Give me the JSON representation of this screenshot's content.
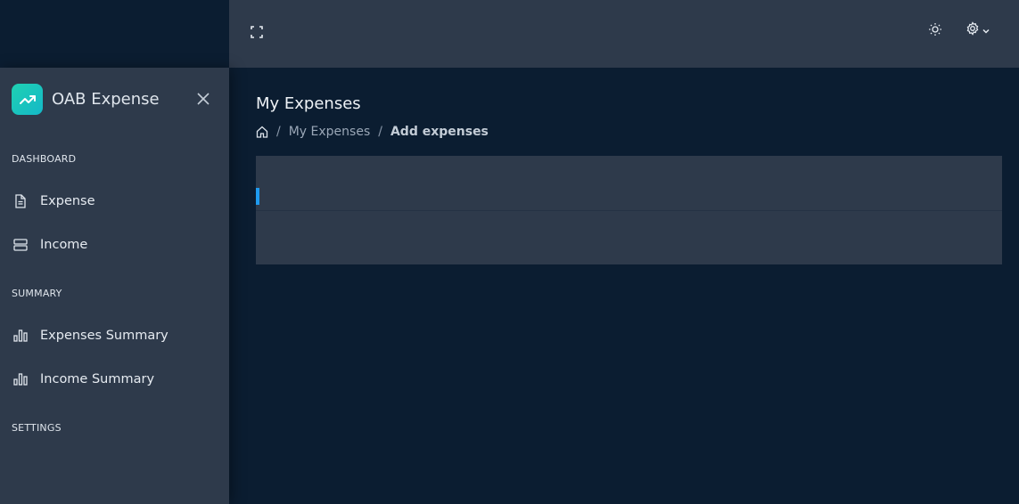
{
  "app": {
    "brand_name": "OAB Expense",
    "accent_color": "#1fd1b2"
  },
  "header": {
    "fullscreen_icon": "fullscreen-icon",
    "theme_icon": "sun-icon",
    "settings_icon": "gear-icon"
  },
  "sidebar": {
    "sections": [
      {
        "label": "DASHBOARD"
      },
      {
        "label": "SUMMARY"
      },
      {
        "label": "SETTINGS"
      }
    ],
    "items": [
      {
        "label": "Expense",
        "icon": "document-icon"
      },
      {
        "label": "Income",
        "icon": "server-icon"
      },
      {
        "label": "Expenses Summary",
        "icon": "bar-chart-icon"
      },
      {
        "label": "Income Summary",
        "icon": "bar-chart-icon"
      }
    ]
  },
  "main": {
    "title": "My Expenses",
    "breadcrumb": {
      "home_icon": "home-icon",
      "link": "My Expenses",
      "current": "Add expenses",
      "separator": "/"
    }
  }
}
